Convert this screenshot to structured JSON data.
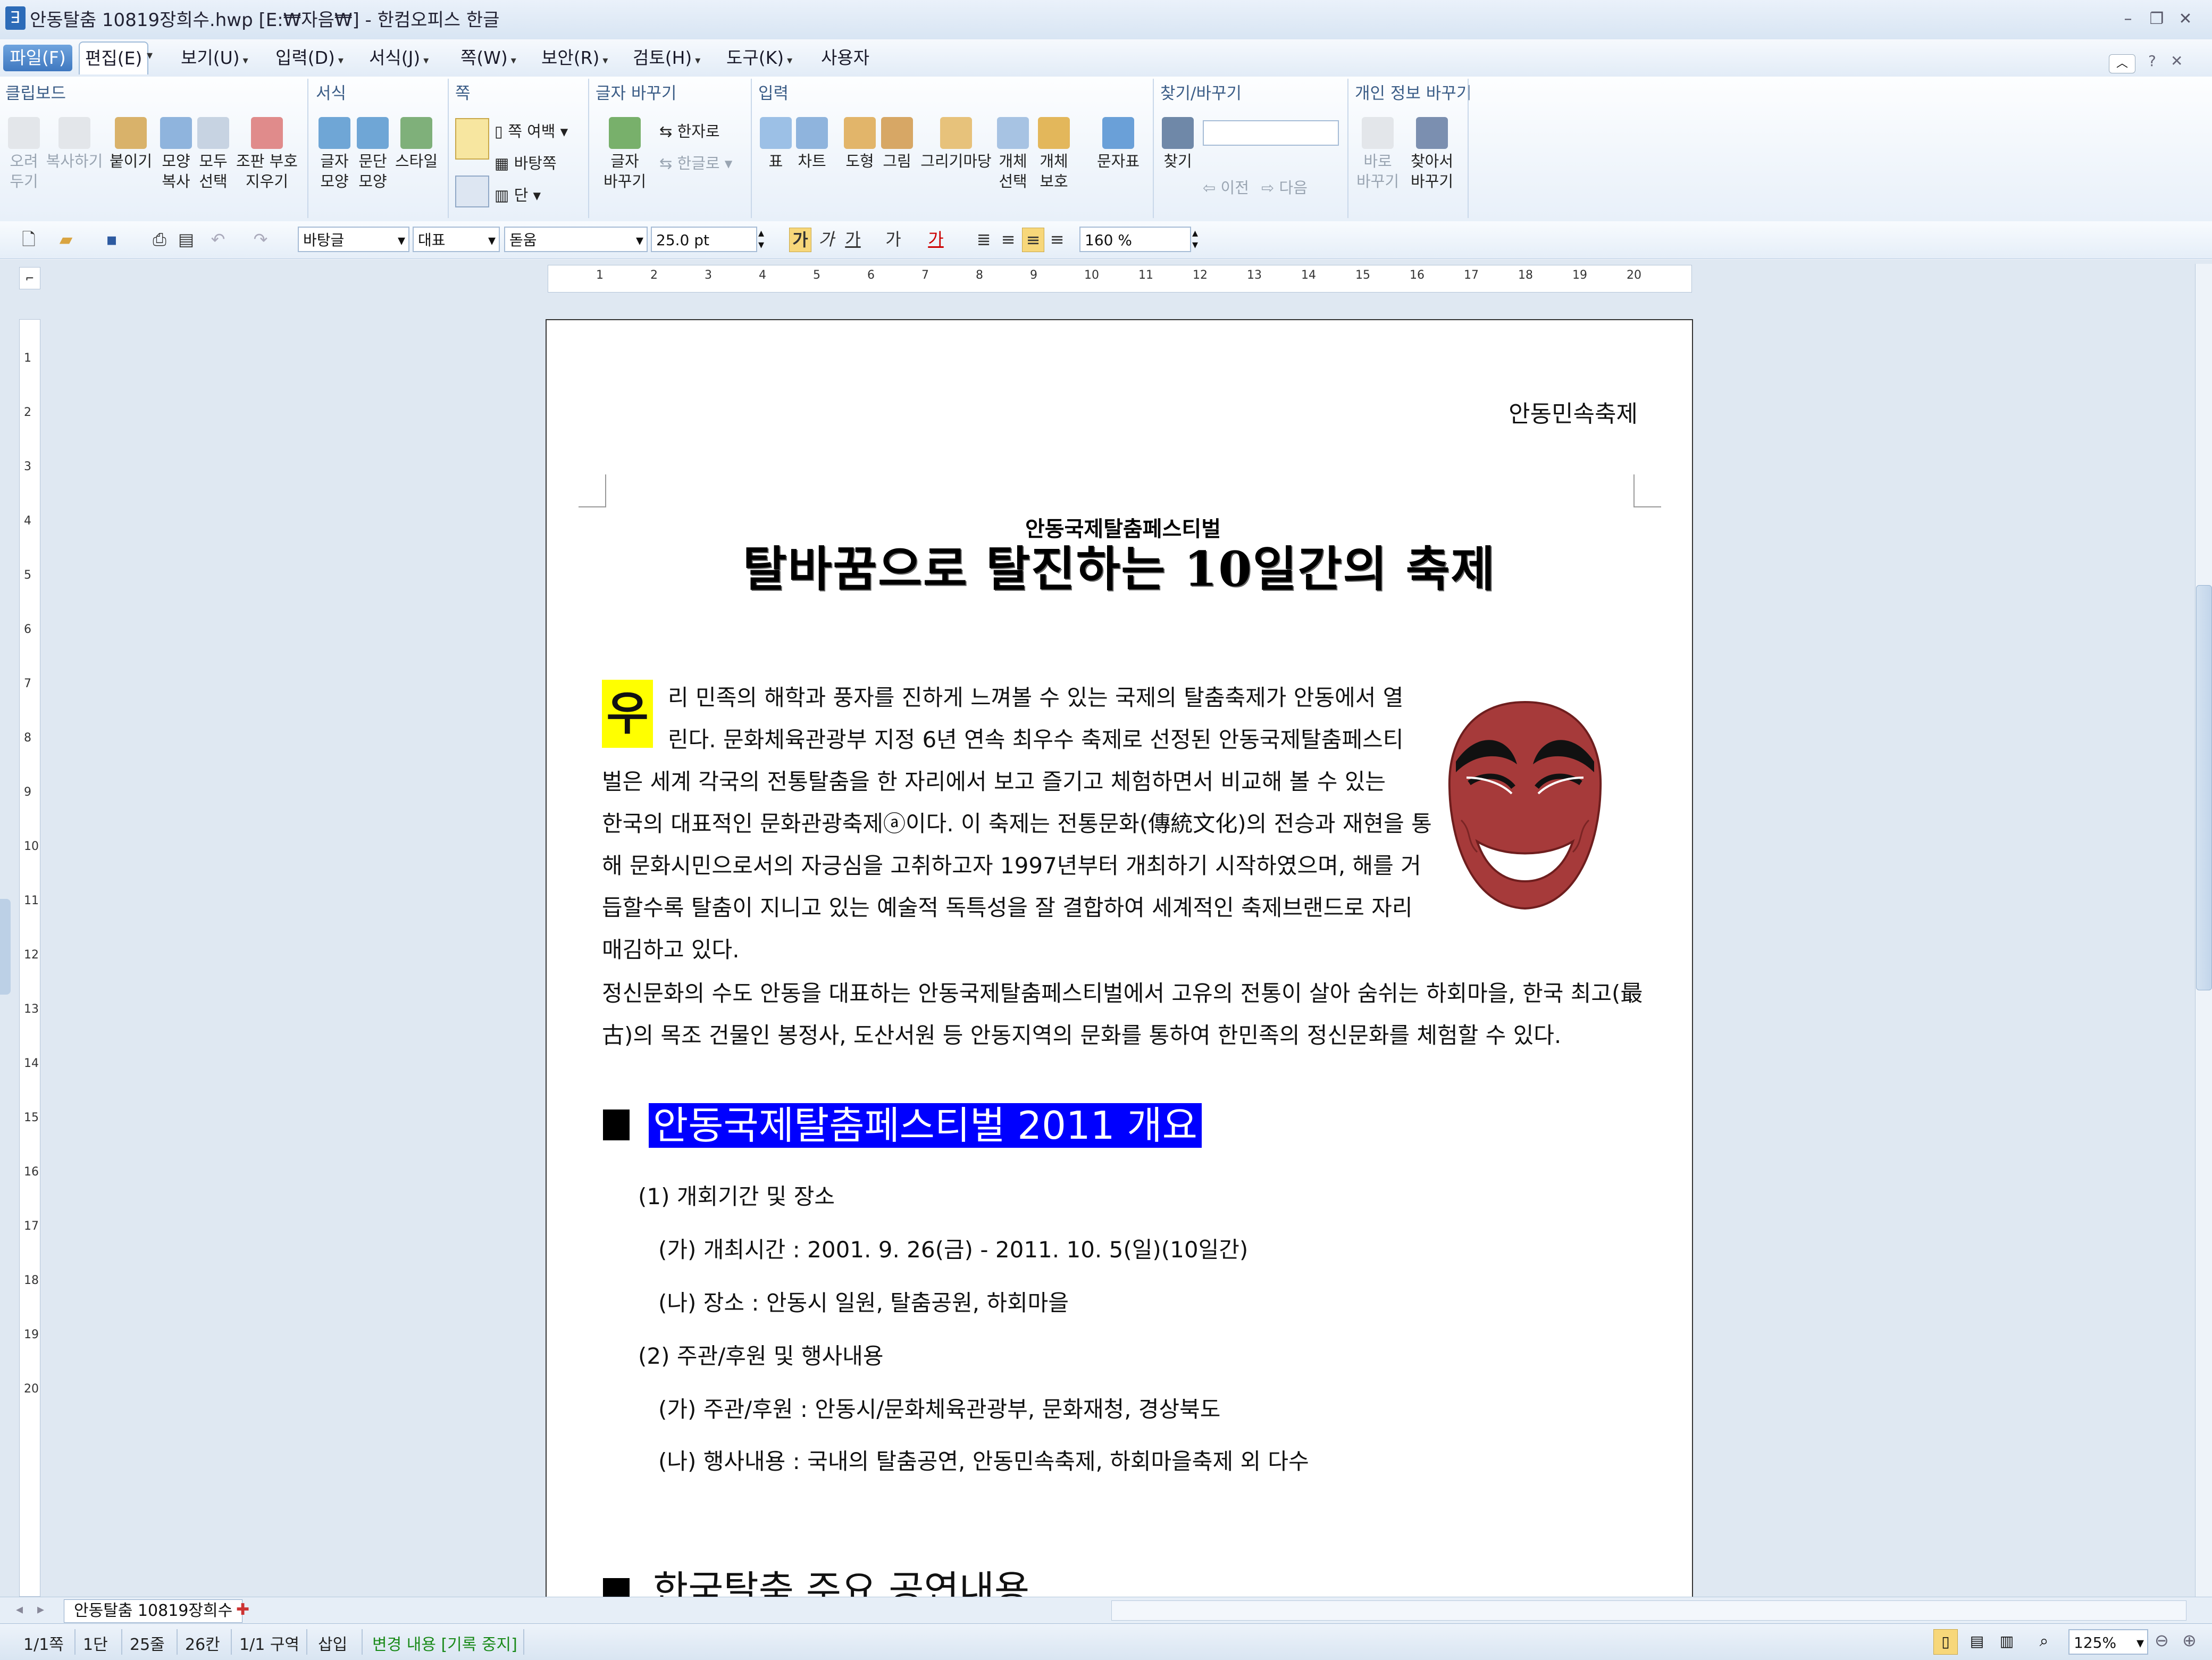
{
  "window": {
    "title": "안동탈춤 10819장희수.hwp [E:₩자음₩] - 한컴오피스 한글",
    "app_icon": "hwp-icon"
  },
  "menu": {
    "items": [
      "파일(F)",
      "편집(E)",
      "보기(U)",
      "입력(D)",
      "서식(J)",
      "쪽(W)",
      "보안(R)",
      "검토(H)",
      "도구(K)",
      "사용자"
    ]
  },
  "ribbon": {
    "groups": {
      "clipboard": "클립보드",
      "format": "서식",
      "page": "쪽",
      "glyph_change": "글자 바꾸기",
      "input": "입력",
      "find_replace": "찾기/바꾸기",
      "privacy": "개인 정보 바꾸기"
    },
    "clipboard": {
      "cut": [
        "오려",
        "두기"
      ],
      "copy": "복사하기",
      "paste": "붙이기",
      "shape_copy": [
        "모양",
        "복사"
      ],
      "select_all": [
        "모두",
        "선택"
      ],
      "remove_markers": [
        "조판 부호",
        "지우기"
      ]
    },
    "format": {
      "char_shape": [
        "글자",
        "모양"
      ],
      "para_shape": [
        "문단",
        "모양"
      ],
      "style": "스타일"
    },
    "page": {
      "margins": "쪽 여백",
      "background": "바탕쪽",
      "columns": "단"
    },
    "glyph": {
      "change": [
        "글자",
        "바꾸기"
      ],
      "to_hanja": "한자로",
      "to_hangul": "한글로"
    },
    "input": {
      "table": "표",
      "chart": "차트",
      "shape": "도형",
      "picture": "그림",
      "drawing_yard": "그리기마당",
      "object_select": [
        "개체",
        "선택"
      ],
      "object_protect": [
        "개체",
        "보호"
      ],
      "char_map": "문자표"
    },
    "find": {
      "find": "찾기",
      "prev": "이전",
      "next": "다음"
    },
    "privacy": {
      "replace_now": [
        "바로",
        "바꾸기"
      ],
      "find_replace": [
        "찾아서",
        "바꾸기"
      ]
    }
  },
  "format_toolbar": {
    "style": "바탕글",
    "lang": "대표",
    "font": "돋움",
    "size": "25.0",
    "size_unit": "pt",
    "line_spacing": "160",
    "line_unit": "%"
  },
  "document": {
    "header_text": "안동민속축제",
    "subtitle": "안동국제탈춤페스티벌",
    "title": "탈바꿈으로 탈진하는 10일간의 축제",
    "dropcap": "우",
    "paragraph1_lines": [
      "리 민족의 해학과 풍자를 진하게 느껴볼 수 있는 국제의 탈춤축제가 안동에서 열",
      "린다. 문화체육관광부 지정 6년 연속 최우수 축제로 선정된 안동국제탈춤페스티",
      "벌은 세계 각국의 전통탈춤을 한 자리에서 보고 즐기고 체험하면서 비교해 볼 수 있는",
      "한국의 대표적인 문화관광축제ⓐ이다. 이 축제는 전통문화(傳統文化)의 전승과 재현을 통",
      "해 문화시민으로서의 자긍심을 고취하고자 1997년부터 개최하기 시작하였으며, 해를 거",
      "듭할수록 탈춤이 지니고 있는 예술적 독특성을 잘 결합하여 세계적인 축제브랜드로 자리",
      "매김하고 있다."
    ],
    "paragraph2_lines": [
      "  정신문화의 수도 안동을 대표하는 안동국제탈춤페스티벌에서 고유의 전통이 살아 숨쉬는 하회마을, 한국 최고(最",
      "古)의 목조 건물인 봉정사, 도산서원 등 안동지역의 문화를 통하여 한민족의 정신문화를 체험할 수 있다."
    ],
    "section1_title": "안동국제탈춤페스티벌 2011 개요",
    "section1_items": [
      "(1) 개회기간 및 장소",
      "(가) 개최시간 : 2001. 9. 26(금) - 2011. 10. 5(일)(10일간)",
      "(나) 장소 : 안동시 일원, 탈춤공원, 하회마을",
      "(2) 주관/후원 및 행사내용",
      "(가) 주관/후원 : 안동시/문화체육관광부, 문화재청, 경상북도",
      "(나) 행사내용 : 국내의 탈춤공연, 안동민속축제, 하회마을축제 외 다수"
    ],
    "section2_title": "한국탈춤 주요 공연내용"
  },
  "ruler_numbers": [
    "1",
    "2",
    "3",
    "4",
    "5",
    "6",
    "7",
    "8",
    "9",
    "10",
    "11",
    "12",
    "13",
    "14",
    "15",
    "16",
    "17",
    "18",
    "19",
    "20"
  ],
  "tabs": {
    "doc_tab": "안동탈춤 10819장희수"
  },
  "status": {
    "page": "1/1쪽",
    "column": "1단",
    "line": "25줄",
    "col": "26칸",
    "section": "1/1 구역",
    "mode": "삽입",
    "track": "변경 내용 [기록 중지]",
    "zoom": "125%"
  },
  "colors": {
    "dropcap_bg": "#ffff00",
    "section_highlight": "#0000ff",
    "mask_face": "#a63a3a"
  }
}
